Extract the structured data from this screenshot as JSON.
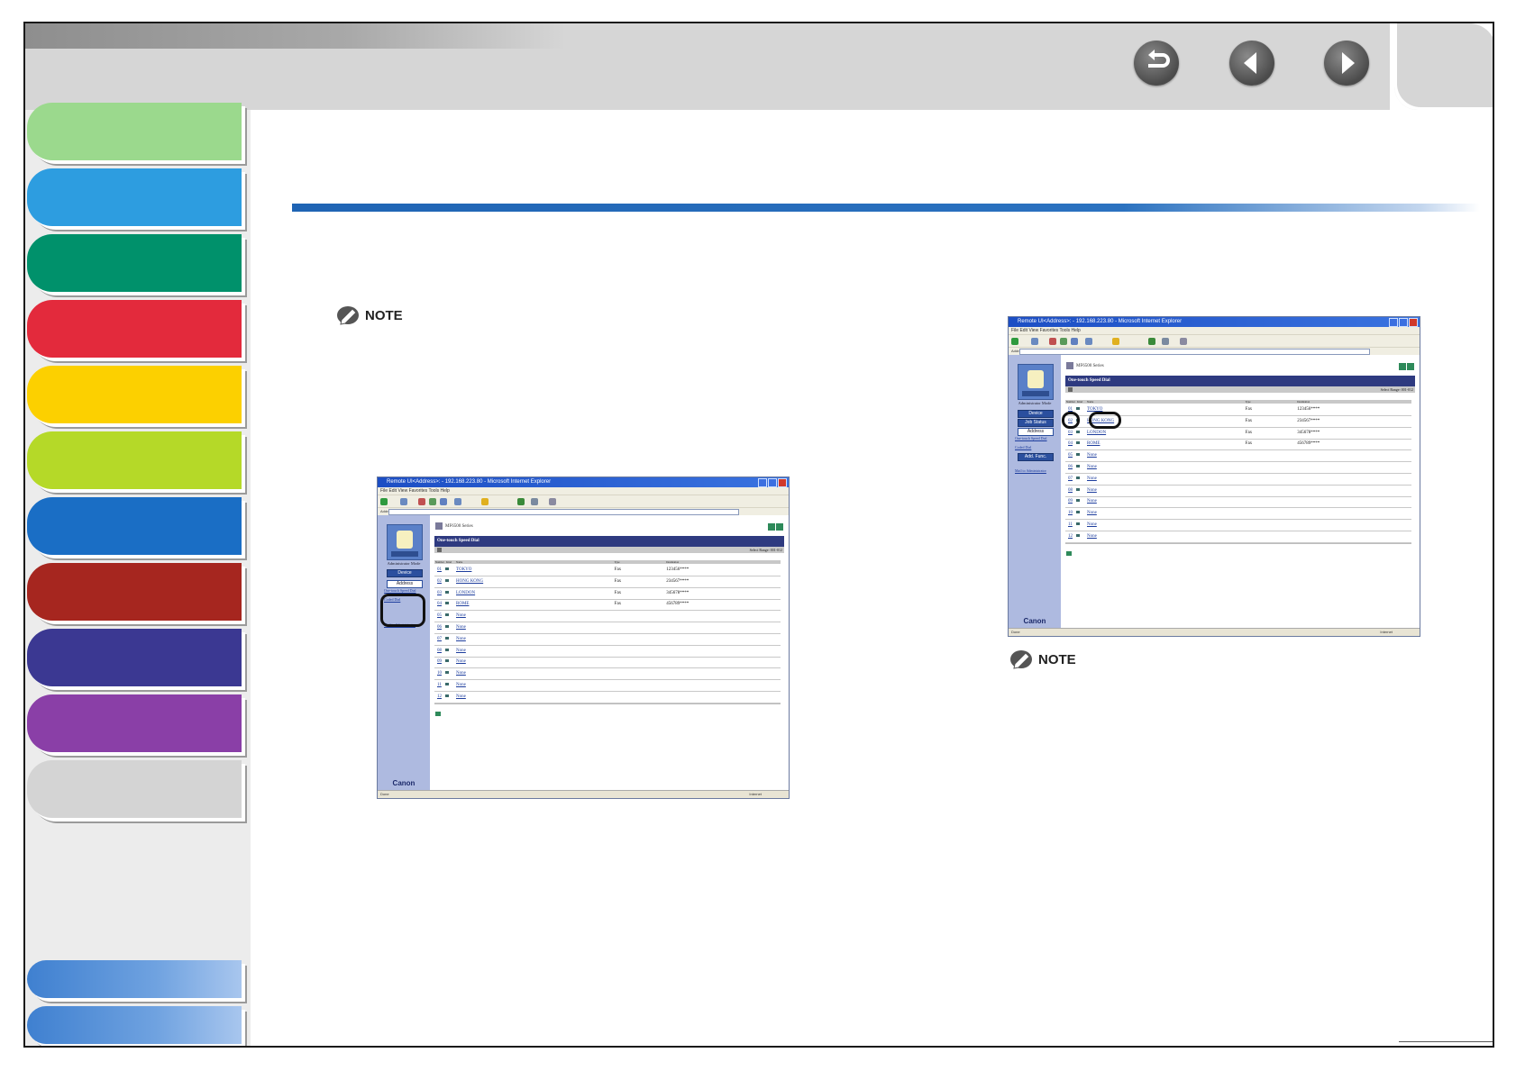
{
  "nav": {
    "back_label": "Back",
    "previous_label": "Previous",
    "next_label": "Next"
  },
  "note_left": {
    "label": "NOTE"
  },
  "note_right": {
    "label": "NOTE"
  },
  "screenshot_left": {
    "window_title": "Remote UI<Address>: - 192.168.223.80 - Microsoft Internet Explorer",
    "menu": "File  Edit  View  Favorites  Tools  Help",
    "address_label": "Address",
    "address_url": "http://192.168.223.80/_ads.htm?id=4",
    "go_label": "Go",
    "series": "MF6500 Series",
    "mode": "Administrator Mode",
    "nav_buttons": {
      "device": "Device",
      "address": "Address"
    },
    "sub_links": [
      "One-touch Speed Dial",
      "Coded Dial"
    ],
    "mail_link": "Mail to Administrator",
    "panel_title": "One-touch Speed Dial",
    "select_range": "Select Range: 001-012",
    "columns": [
      "Number",
      "Kind",
      "Name",
      "Type",
      "Destination"
    ],
    "rows": [
      {
        "no": "01",
        "name": "TOKYO",
        "type": "Fax",
        "dest": "123456****"
      },
      {
        "no": "02",
        "name": "HONG KONG",
        "type": "Fax",
        "dest": "234567****"
      },
      {
        "no": "03",
        "name": "LONDON",
        "type": "Fax",
        "dest": "345678****"
      },
      {
        "no": "04",
        "name": "ROME",
        "type": "Fax",
        "dest": "456789****"
      },
      {
        "no": "05",
        "name": "None",
        "type": "",
        "dest": ""
      },
      {
        "no": "06",
        "name": "None",
        "type": "",
        "dest": ""
      },
      {
        "no": "07",
        "name": "None",
        "type": "",
        "dest": ""
      },
      {
        "no": "08",
        "name": "None",
        "type": "",
        "dest": ""
      },
      {
        "no": "09",
        "name": "None",
        "type": "",
        "dest": ""
      },
      {
        "no": "10",
        "name": "None",
        "type": "",
        "dest": ""
      },
      {
        "no": "11",
        "name": "None",
        "type": "",
        "dest": ""
      },
      {
        "no": "12",
        "name": "None",
        "type": "",
        "dest": ""
      }
    ],
    "brand": "Canon",
    "status_left": "Done",
    "status_right": "Internet"
  },
  "screenshot_right": {
    "window_title": "Remote UI<Address>: - 192.168.223.80 - Microsoft Internet Explorer",
    "menu": "File  Edit  View  Favorites  Tools  Help",
    "address_label": "Address",
    "address_url": "http://192.168.223.80/_ads.htm?id=4",
    "go_label": "Go",
    "series": "MF6500 Series",
    "mode": "Administrator Mode",
    "nav_buttons": {
      "device": "Device",
      "job_status": "Job Status",
      "address": "Address",
      "add_func": "Add. Func."
    },
    "sub_links": [
      "One-touch Speed Dial",
      "Coded Dial"
    ],
    "mail_link": "Mail to Administrator",
    "panel_title": "One-touch Speed Dial",
    "select_range": "Select Range: 001-012",
    "columns": [
      "Number",
      "Kind",
      "Name",
      "Type",
      "Destination"
    ],
    "rows": [
      {
        "no": "01",
        "name": "TOKYO",
        "type": "Fax",
        "dest": "123456****"
      },
      {
        "no": "02",
        "name": "HONG KONG",
        "type": "Fax",
        "dest": "234567****"
      },
      {
        "no": "03",
        "name": "LONDON",
        "type": "Fax",
        "dest": "345678****"
      },
      {
        "no": "04",
        "name": "ROME",
        "type": "Fax",
        "dest": "456789****"
      },
      {
        "no": "05",
        "name": "None",
        "type": "",
        "dest": ""
      },
      {
        "no": "06",
        "name": "None",
        "type": "",
        "dest": ""
      },
      {
        "no": "07",
        "name": "None",
        "type": "",
        "dest": ""
      },
      {
        "no": "08",
        "name": "None",
        "type": "",
        "dest": ""
      },
      {
        "no": "09",
        "name": "None",
        "type": "",
        "dest": ""
      },
      {
        "no": "10",
        "name": "None",
        "type": "",
        "dest": ""
      },
      {
        "no": "11",
        "name": "None",
        "type": "",
        "dest": ""
      },
      {
        "no": "12",
        "name": "None",
        "type": "",
        "dest": ""
      }
    ],
    "brand": "Canon",
    "status_left": "Done",
    "status_right": "Internet"
  },
  "colors": {
    "sidebar_tabs": [
      "#9bd98d",
      "#2d9de0",
      "#00916b",
      "#e32a3c",
      "#fcd000",
      "#b5d928",
      "#1a6ec5",
      "#a6261f",
      "#3b3892",
      "#8a3fa7",
      "#d4d4d4"
    ],
    "rule": "#1f64b4",
    "nav_button": "#555555"
  }
}
